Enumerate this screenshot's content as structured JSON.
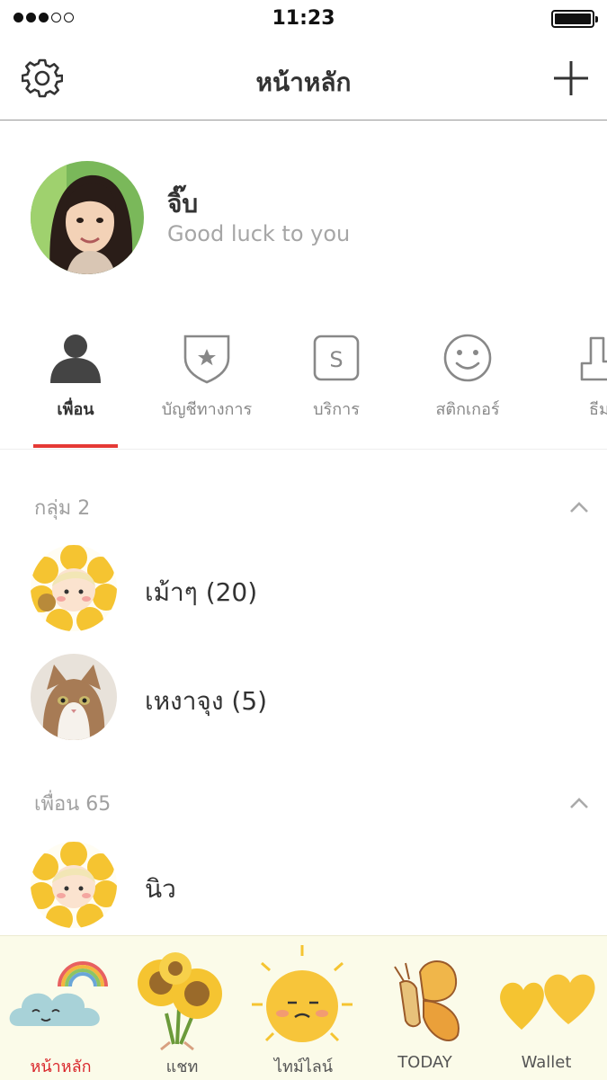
{
  "status_bar": {
    "time": "11:23"
  },
  "header": {
    "title": "หน้าหลัก",
    "settings_icon": "gear-icon",
    "add_icon": "plus-icon"
  },
  "profile": {
    "name": "จิ๊บ",
    "status": "Good luck to you"
  },
  "tabs": [
    {
      "label": "เพื่อน",
      "icon": "person-icon",
      "active": true
    },
    {
      "label": "บัญชีทางการ",
      "icon": "official-shield-icon"
    },
    {
      "label": "บริการ",
      "icon": "service-s-icon"
    },
    {
      "label": "สติกเกอร์",
      "icon": "smiley-icon"
    },
    {
      "label": "ธีม",
      "icon": "theme-brush-icon"
    }
  ],
  "groups": {
    "header": "กลุ่ม 2",
    "items": [
      {
        "label": "เม้าๆ (20)"
      },
      {
        "label": "เหงาจุง (5)"
      }
    ]
  },
  "friends": {
    "header": "เพื่อน 65",
    "items": [
      {
        "label": "นิว"
      }
    ]
  },
  "bottom_nav": [
    {
      "label": "หน้าหลัก",
      "icon": "cloud-rainbow-icon",
      "active": true
    },
    {
      "label": "แชท",
      "icon": "sunflower-bouquet-icon"
    },
    {
      "label": "ไทม์ไลน์",
      "icon": "sun-icon"
    },
    {
      "label": "TODAY",
      "icon": "butterfly-icon"
    },
    {
      "label": "Wallet",
      "icon": "hearts-icon"
    }
  ],
  "colors": {
    "accent": "#e53935",
    "bottom_bar_bg": "#fbfbe9",
    "active_bottom_label": "#d9262b"
  }
}
